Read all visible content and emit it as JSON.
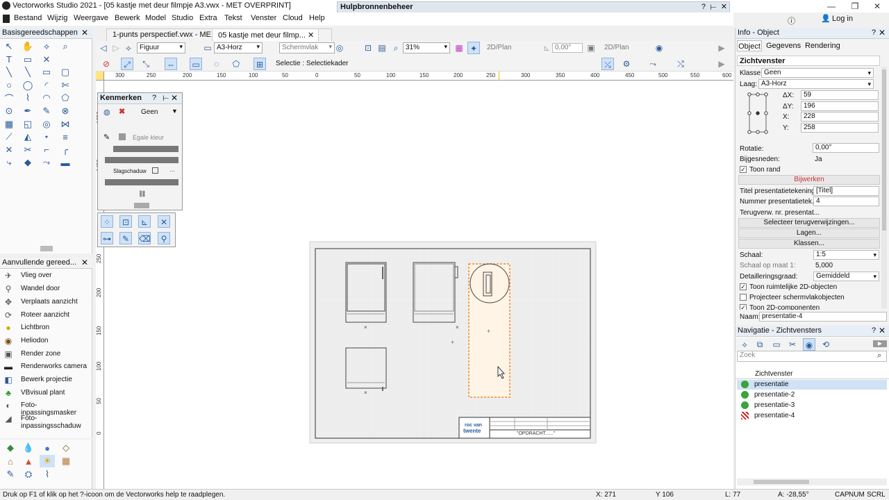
{
  "window": {
    "title": "Vectorworks Studio 2021 - [05 kastje met deur filmpje A3.vwx - MET OVERPRINT]",
    "floating_title": "Hulpbronnenbeheer",
    "login": "Log in"
  },
  "menu": [
    "Bestand",
    "Wijzig",
    "Weergave",
    "Bewerk",
    "Model",
    "Studio",
    "Extra",
    "Tekst",
    "Venster",
    "Cloud",
    "Help"
  ],
  "tabs": [
    {
      "label": "1-punts perspectief.vwx - ME..."
    },
    {
      "label": "05 kastje met deur filmp..."
    }
  ],
  "toolbar1": {
    "class_dd": "Figuur",
    "layer_dd": "A3-Horz",
    "view_dd": "Schermvlak",
    "zoom_dd": "31%",
    "mode1": "2D/Plan",
    "angle": "0,00°",
    "mode2": "2D/Plan"
  },
  "toolbar2": {
    "selection_label": "Selectie : Selectiekader"
  },
  "ruler": {
    "h": [
      "300",
      "250",
      "200",
      "150",
      "100",
      "50",
      "0",
      "50",
      "100",
      "150",
      "200",
      "250",
      "300",
      "350",
      "400",
      "450",
      "500",
      "550",
      "600"
    ],
    "v": [
      "1650",
      "1450",
      "250",
      "200",
      "150",
      "100",
      "50",
      "0"
    ]
  },
  "left_palette_top": {
    "title": "Basisgereedschappen"
  },
  "left_palette_list": {
    "title": "Aanvullende gereed...",
    "items": [
      {
        "label": "Vlieg over",
        "icon": "fly-icon"
      },
      {
        "label": "Wandel door",
        "icon": "walk-icon"
      },
      {
        "label": "Verplaats aanzicht",
        "icon": "move-view-icon"
      },
      {
        "label": "Roteer aanzicht",
        "icon": "rotate-view-icon"
      },
      {
        "label": "Lichtbron",
        "icon": "light-icon"
      },
      {
        "label": "Heliodon",
        "icon": "heliodon-icon"
      },
      {
        "label": "Render zone",
        "icon": "render-zone-icon"
      },
      {
        "label": "Renderworks camera",
        "icon": "camera-icon"
      },
      {
        "label": "Bewerk projectie",
        "icon": "projection-icon"
      },
      {
        "label": "VBvisual plant",
        "icon": "plant-icon"
      },
      {
        "label": "Foto-inpassingsmasker",
        "icon": "mask-icon"
      },
      {
        "label": "Foto-inpassingsschaduw",
        "icon": "shadow-icon"
      }
    ]
  },
  "kenmerken": {
    "title": "Kenmerken",
    "fill": "Geen",
    "color": "Egale kleur",
    "shadow": "Slagschaduw"
  },
  "drawing": {
    "logo1": "roc van",
    "logo2": "twente",
    "title_block": "\"OPDRACHT......\""
  },
  "info": {
    "title": "Info - Object",
    "tabs": [
      "Object",
      "Gegevens",
      "Rendering"
    ],
    "object_type": "Zichtvenster",
    "klasse_label": "Klasse:",
    "klasse": "Geen",
    "laag_label": "Laag:",
    "laag": "A3-Horz",
    "dx_label": "ΔX:",
    "dx": "59",
    "dy_label": "ΔY:",
    "dy": "196",
    "x_label": "X:",
    "x": "228",
    "y_label": "Y:",
    "y": "258",
    "rotatie_label": "Rotatie:",
    "rotatie": "0,00°",
    "bijgesneden_label": "Bijgesneden:",
    "bijgesneden": "Ja",
    "toon_rand": "Toon rand",
    "bijwerken": "Bijwerken",
    "titel_label": "Titel presentatietekening:",
    "titel": "[Titel]",
    "nummer_label": "Nummer presentatietek...",
    "nummer": "4",
    "terug_label": "Terugverw. nr. presentat...",
    "btn_terug": "Selecteer terugverwijzingen...",
    "btn_lagen": "Lagen...",
    "btn_klassen": "Klassen...",
    "schaal_label": "Schaal:",
    "schaal": "1:5",
    "schaal_maat_label": "Schaal op maat 1:",
    "schaal_maat": "5,000",
    "detail_label": "Detailleringsgraad:",
    "detail": "Gemiddeld",
    "opt1": "Toon ruimtelijke 2D-objecten",
    "opt2": "Projecteer schermvlakobjecten",
    "opt3": "Toon 2D-componenten",
    "naam_label": "Naam:",
    "naam": "presentatie-4"
  },
  "nav": {
    "title": "Navigatie - Zichtvensters",
    "search_placeholder": "Zoek",
    "column": "Zichtvenster",
    "items": [
      {
        "label": "presentatie",
        "selected": true
      },
      {
        "label": "presentatie-2",
        "selected": false
      },
      {
        "label": "presentatie-3",
        "selected": false
      },
      {
        "label": "presentatie-4",
        "selected": false
      }
    ]
  },
  "status": {
    "help": "Druk op F1 of klik op het ?-icoon om de Vectorworks help te raadplegen.",
    "x": "X: 271",
    "y": "Y 106",
    "l": "L: 77",
    "a": "A: -28,55°",
    "caps": "CAP",
    "num": "NUM",
    "scrl": "SCRL"
  },
  "colors": {
    "selected": "#cfe2f6",
    "accent": "#2a5a9a",
    "highlight_orange": "#f08c2a",
    "red": "#cc2222"
  }
}
